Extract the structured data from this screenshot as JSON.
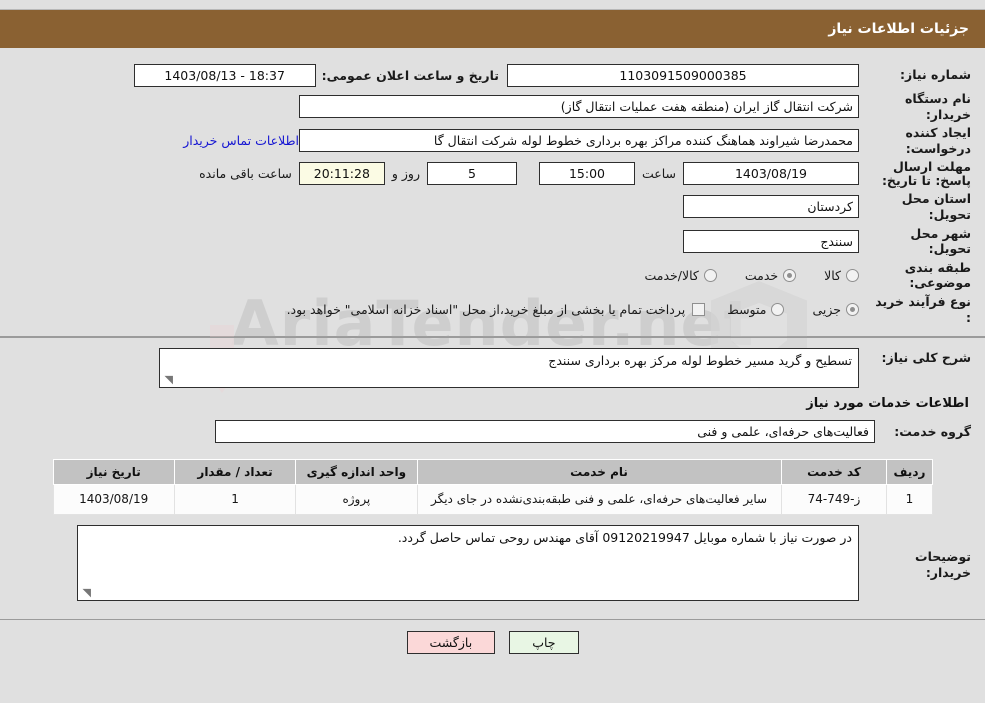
{
  "header": {
    "title": "جزئیات اطلاعات نیاز"
  },
  "form": {
    "need_number_label": "شماره نیاز:",
    "need_number_value": "1103091509000385",
    "announce_label": "تاریخ و ساعت اعلان عمومی:",
    "announce_value": "1403/08/13 - 18:37",
    "buyer_org_label": "نام دستگاه خریدار:",
    "buyer_org_value": "شرکت انتقال گاز ایران (منطقه هفت عملیات انتقال گاز)",
    "creator_label": "ایجاد کننده درخواست:",
    "creator_value": "محمدرضا شیراوند هماهنگ کننده مراکز بهره برداری خطوط لوله  شرکت انتقال گا",
    "contact_link": "اطلاعات تماس خریدار",
    "deadline_label": "مهلت ارسال پاسخ: تا تاریخ:",
    "deadline_date": "1403/08/19",
    "deadline_time_label": "ساعت",
    "deadline_time": "15:00",
    "remaining_days": "5",
    "remaining_days_label": "روز و",
    "remaining_clock": "20:11:28",
    "remaining_clock_label": "ساعت باقی مانده",
    "province_label": "استان محل تحویل:",
    "province_value": "کردستان",
    "city_label": "شهر محل تحویل:",
    "city_value": "سنندج",
    "category_label": "طبقه بندی موضوعی:",
    "category_options": [
      {
        "label": "کالا",
        "checked": false
      },
      {
        "label": "خدمت",
        "checked": true
      },
      {
        "label": "کالا/خدمت",
        "checked": false
      }
    ],
    "process_label": "نوع فرآیند خرید :",
    "process_options": [
      {
        "label": "جزیی",
        "checked": true
      },
      {
        "label": "متوسط",
        "checked": false
      }
    ],
    "treasury_checkbox_text": "پرداخت تمام یا بخشی از مبلغ خرید،از محل \"اسناد خزانه اسلامی\" خواهد بود.",
    "treasury_checked": false
  },
  "details": {
    "general_desc_label": "شرح کلی نیاز:",
    "general_desc_value": "تسطیح و گرید مسیر خطوط لوله مرکز بهره برداری سنندج",
    "services_section_title": "اطلاعات خدمات مورد نیاز",
    "service_group_label": "گروه خدمت:",
    "service_group_value": "فعالیت‌های حرفه‌ای، علمی و فنی",
    "buyer_notes_label": "توضیحات خریدار:",
    "buyer_notes_value": "در صورت نیاز با شماره موبایل 09120219947 آقای مهندس روحی تماس حاصل گردد."
  },
  "table": {
    "columns": [
      "ردیف",
      "کد خدمت",
      "نام خدمت",
      "واحد اندازه گیری",
      "تعداد / مقدار",
      "تاریخ نیاز"
    ],
    "rows": [
      {
        "radif": "1",
        "code": "ز-749-74",
        "name": "سایر فعالیت‌های حرفه‌ای، علمی و فنی طبقه‌بندی‌نشده در جای دیگر",
        "unit": "پروژه",
        "qty": "1",
        "date": "1403/08/19"
      }
    ]
  },
  "footer": {
    "print_label": "چاپ",
    "back_label": "بازگشت"
  },
  "watermark": {
    "text": "AriaTender.net"
  }
}
